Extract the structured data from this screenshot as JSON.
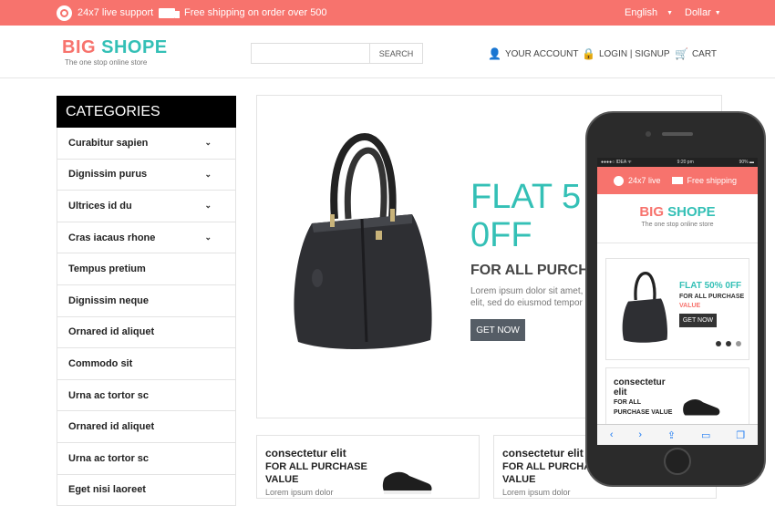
{
  "topbar": {
    "support_text": "24x7 live support",
    "shipping_text": "Free shipping on order over 500",
    "language": "English",
    "currency": "Dollar",
    "bg_color": "#f7736d"
  },
  "header": {
    "logo_big": "BIG",
    "logo_shope": "SHOPE",
    "tagline": "The one stop online store",
    "search_button": "SEARCH",
    "search_placeholder": "",
    "account_label": "YOUR ACCOUNT",
    "login_label": "LOGIN | SIGNUP",
    "cart_label": "CART"
  },
  "categories": {
    "title": "CATEGORIES",
    "items": [
      {
        "label": "Curabitur sapien",
        "chevron": true
      },
      {
        "label": "Dignissim purus",
        "chevron": true
      },
      {
        "label": "Ultrices id du",
        "chevron": true
      },
      {
        "label": "Cras iacaus rhone",
        "chevron": true
      },
      {
        "label": "Tempus pretium",
        "chevron": false
      },
      {
        "label": "Dignissim neque",
        "chevron": false
      },
      {
        "label": "Ornared id aliquet",
        "chevron": false
      },
      {
        "label": "Commodo sit",
        "chevron": false
      },
      {
        "label": "Urna ac tortor sc",
        "chevron": false
      },
      {
        "label": "Ornared id aliquet",
        "chevron": false
      },
      {
        "label": "Urna ac tortor sc",
        "chevron": false
      },
      {
        "label": "Eget nisi laoreet",
        "chevron": false
      }
    ]
  },
  "banner": {
    "headline_1": "FLAT 5",
    "headline_2": "0FF",
    "subhead": "FOR ALL PURCH",
    "lorem_1": "Lorem ipsum dolor sit amet, co",
    "lorem_2": "elit, sed do eiusmod tempor in",
    "cta": "GET NOW"
  },
  "cards": [
    {
      "title": "consectetur elit",
      "subtitle": "FOR ALL PURCHASE VALUE",
      "text": "Lorem ipsum dolor"
    },
    {
      "title": "consectetur elit",
      "subtitle": "FOR ALL PURCHASE VALUE",
      "text": "Lorem ipsum dolor"
    }
  ],
  "mobile": {
    "status_left": "●●●●○ IDEA ᯤ",
    "status_time": "9:20 pm",
    "status_right": "90% ▬",
    "top_live": "24x7 live",
    "top_shipping": "Free shipping",
    "logo_big": "BIG",
    "logo_shope": "SHOPE",
    "tagline": "The one stop online store",
    "flat": "FLAT 50% 0FF",
    "forall": "FOR ALL PURCHASE",
    "value": "VALUE",
    "cta": "GET NOW",
    "card_title": "consectetur elit",
    "card_sub": "FOR ALL PURCHASE VALUE"
  }
}
